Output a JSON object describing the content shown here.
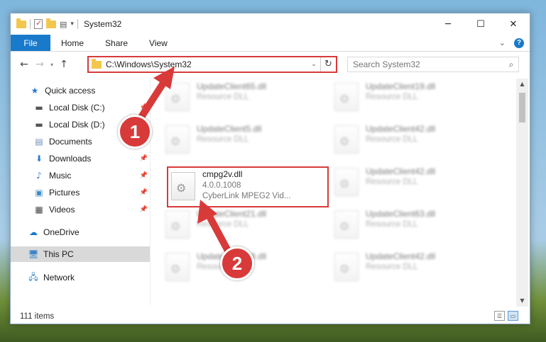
{
  "window": {
    "title": "System32"
  },
  "ribbon": {
    "tabs": [
      "File",
      "Home",
      "Share",
      "View"
    ]
  },
  "nav": {
    "address": "C:\\Windows\\System32",
    "search_placeholder": "Search System32"
  },
  "sidebar": {
    "items": [
      {
        "label": "Quick access",
        "icon": "star-icon",
        "pinned": false
      },
      {
        "label": "Local Disk (C:)",
        "icon": "drive-icon",
        "pinned": true
      },
      {
        "label": "Local Disk (D:)",
        "icon": "drive-icon",
        "pinned": true
      },
      {
        "label": "Documents",
        "icon": "documents-icon",
        "pinned": true
      },
      {
        "label": "Downloads",
        "icon": "download-icon",
        "pinned": true
      },
      {
        "label": "Music",
        "icon": "music-icon",
        "pinned": true
      },
      {
        "label": "Pictures",
        "icon": "pictures-icon",
        "pinned": true
      },
      {
        "label": "Videos",
        "icon": "videos-icon",
        "pinned": true
      },
      {
        "label": "OneDrive",
        "icon": "cloud-icon",
        "pinned": false
      },
      {
        "label": "This PC",
        "icon": "computer-icon",
        "pinned": false,
        "selected": true
      },
      {
        "label": "Network",
        "icon": "network-icon",
        "pinned": false
      }
    ]
  },
  "files": [
    {
      "name": "UpdateClient65.dll",
      "sub": "Resource DLL"
    },
    {
      "name": "UpdateClient19.dll",
      "sub": "Resource DLL"
    },
    {
      "name": "UpdateClient5.dll",
      "sub": "Resource DLL"
    },
    {
      "name": "UpdateClient42.dll",
      "sub": "Resource DLL"
    },
    {
      "name": "cmpg2v.dll",
      "version": "4.0.0.1008",
      "sub": "CyberLink MPEG2 Vid...",
      "highlighted": true
    },
    {
      "name": "UpdateClient42.dll",
      "sub": "Resource DLL"
    },
    {
      "name": "UpdateClient21.dll",
      "sub": "Resource DLL"
    },
    {
      "name": "UpdateClient63.dll",
      "sub": "Resource DLL"
    },
    {
      "name": "UpdateClient19.dll",
      "sub": "Resource DLL"
    },
    {
      "name": "UpdateClient42.dll",
      "sub": "Resource DLL"
    }
  ],
  "status": {
    "count": "111 items"
  },
  "callouts": [
    "1",
    "2"
  ],
  "colors": {
    "accent": "#1979ca",
    "highlight": "#d83a3a"
  }
}
